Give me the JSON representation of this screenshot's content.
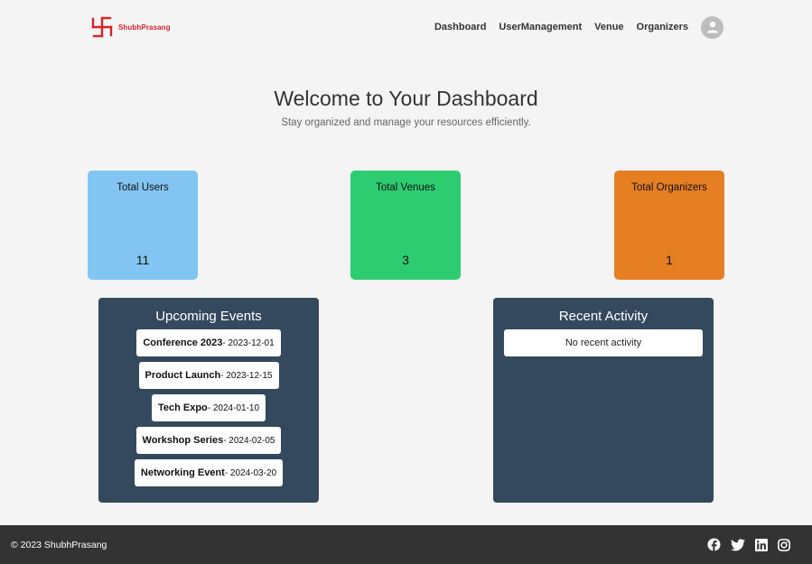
{
  "brand": {
    "name": "ShubhPrasang",
    "accent": "#d8232a"
  },
  "nav": {
    "links": [
      {
        "label": "Dashboard"
      },
      {
        "label": "UserManagement"
      },
      {
        "label": "Venue"
      },
      {
        "label": "Organizers"
      }
    ],
    "avatar_icon": "user-avatar-icon"
  },
  "hero": {
    "title": "Welcome to Your Dashboard",
    "subtitle": "Stay organized and manage your resources efficiently."
  },
  "stats": {
    "users": {
      "label": "Total Users",
      "value": "11",
      "color": "#83c5f2"
    },
    "venues": {
      "label": "Total Venues",
      "value": "3",
      "color": "#2ecc71"
    },
    "organizers": {
      "label": "Total Organizers",
      "value": "1",
      "color": "#e67e22"
    }
  },
  "upcoming_events": {
    "title": "Upcoming Events",
    "items": [
      {
        "name": "Conference 2023",
        "date": " - 2023-12-01"
      },
      {
        "name": "Product Launch",
        "date": " - 2023-12-15"
      },
      {
        "name": "Tech Expo",
        "date": " - 2024-01-10"
      },
      {
        "name": "Workshop Series",
        "date": " - 2024-02-05"
      },
      {
        "name": "Networking Event",
        "date": " - 2024-03-20"
      }
    ]
  },
  "recent_activity": {
    "title": "Recent Activity",
    "empty_text": "No recent activity"
  },
  "footer": {
    "copyright": "© 2023 ShubhPrasang",
    "social_icons": [
      "facebook-icon",
      "twitter-icon",
      "linkedin-icon",
      "instagram-icon"
    ]
  },
  "colors": {
    "panel": "#34495e",
    "footer": "#333333",
    "background": "#f4f4f4"
  }
}
